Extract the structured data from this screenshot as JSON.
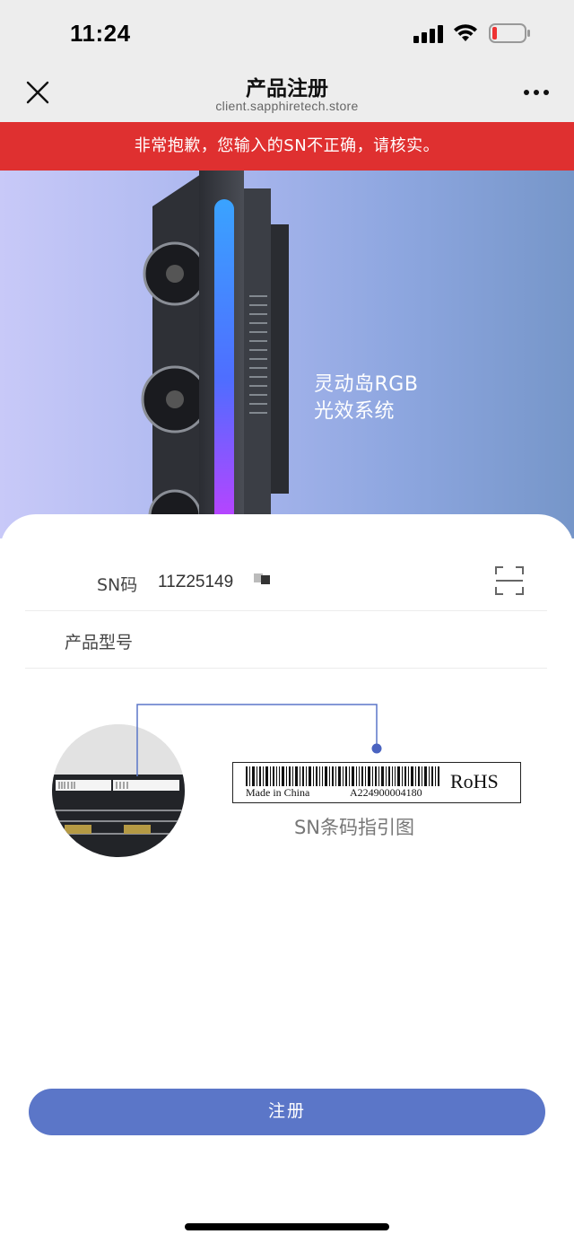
{
  "status_bar": {
    "time": "11:24"
  },
  "nav": {
    "title": "产品注册",
    "url": "client.sapphiretech.store",
    "close_icon": "close-icon",
    "more_icon": "more-horizontal-icon"
  },
  "error_banner": {
    "message": "非常抱歉，您输入的SN不正确，请核实。",
    "color": "#df3030"
  },
  "hero": {
    "caption_line1": "灵动岛RGB",
    "caption_line2": "光效系统"
  },
  "form": {
    "sn_label": "SN码",
    "sn_value": "11Z25149",
    "model_label": "产品型号",
    "scan_icon": "scan-icon"
  },
  "guide": {
    "made_in": "Made in China",
    "sn_example": "A224900004180",
    "rohs": "RoHS",
    "caption": "SN条码指引图"
  },
  "submit": {
    "label": "注册",
    "color": "#5b76c8"
  }
}
